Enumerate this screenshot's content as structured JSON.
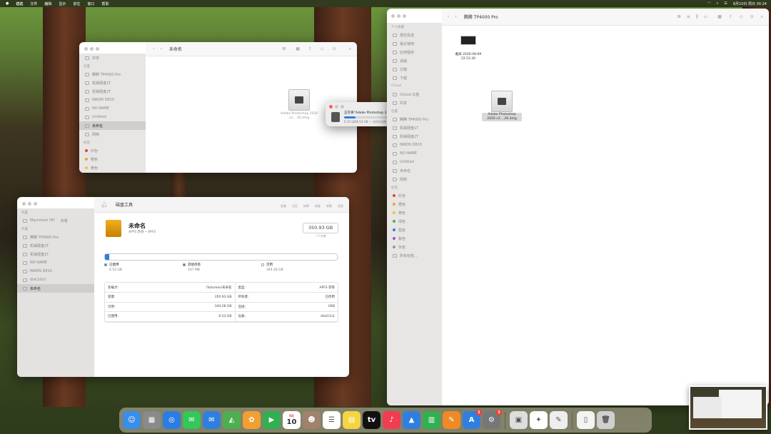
{
  "menubar": {
    "items": [
      "访达",
      "文件",
      "编辑",
      "显示",
      "前往",
      "窗口",
      "帮助"
    ],
    "datetime": "8月10日 周日 00:24"
  },
  "finder_small": {
    "title": "未命名",
    "sidebar": [
      {
        "type": "item",
        "label": "共享"
      },
      {
        "type": "head",
        "label": "位置"
      },
      {
        "type": "item",
        "label": "腾腾 TP4000 Pro"
      },
      {
        "type": "item",
        "label": "机械硬盘1T"
      },
      {
        "type": "item",
        "label": "机械硬盘2T"
      },
      {
        "type": "item",
        "label": "NIKON D810"
      },
      {
        "type": "item",
        "label": "NO NAME"
      },
      {
        "type": "item",
        "label": "Untitled"
      },
      {
        "type": "item",
        "label": "未命名",
        "selected": true
      },
      {
        "type": "item",
        "label": "网络"
      },
      {
        "type": "head",
        "label": "标签"
      },
      {
        "type": "tag",
        "label": "红色",
        "color": "#e0443a"
      },
      {
        "type": "tag",
        "label": "橙色",
        "color": "#f0a030"
      },
      {
        "type": "tag",
        "label": "黄色",
        "color": "#e8c630"
      }
    ],
    "file_label": "Adobe Photoshop 2026 v2....26.dmg"
  },
  "copy_dialog": {
    "title": "正在将“Adobe Photoshop 2...26.0.0.26.dmg”拷贝至“未命名”",
    "progress_pct": 12,
    "detail": "6.15 GB/6.52 GB — 大约1分钟"
  },
  "finder_large": {
    "title": "腾腾 TP4000 Pro",
    "sidebar": [
      {
        "type": "head",
        "label": "个人收藏"
      },
      {
        "type": "item",
        "label": "隔空投送"
      },
      {
        "type": "item",
        "label": "最近使用"
      },
      {
        "type": "item",
        "label": "应用程序"
      },
      {
        "type": "item",
        "label": "桌面"
      },
      {
        "type": "item",
        "label": "文稿"
      },
      {
        "type": "item",
        "label": "下载"
      },
      {
        "type": "head",
        "label": "iCloud"
      },
      {
        "type": "item",
        "label": "iCloud 云盘"
      },
      {
        "type": "item",
        "label": "共享"
      },
      {
        "type": "head",
        "label": "位置"
      },
      {
        "type": "item",
        "label": "腾腾 TP4000 Pro"
      },
      {
        "type": "item",
        "label": "机械硬盘1T"
      },
      {
        "type": "item",
        "label": "机械硬盘2T"
      },
      {
        "type": "item",
        "label": "NIKON D810"
      },
      {
        "type": "item",
        "label": "NO NAME"
      },
      {
        "type": "item",
        "label": "Untitled"
      },
      {
        "type": "item",
        "label": "未命名"
      },
      {
        "type": "item",
        "label": "网络"
      },
      {
        "type": "head",
        "label": "标签"
      },
      {
        "type": "tag",
        "label": "红色",
        "color": "#e0443a"
      },
      {
        "type": "tag",
        "label": "橙色",
        "color": "#f0a030"
      },
      {
        "type": "tag",
        "label": "黄色",
        "color": "#e8c630"
      },
      {
        "type": "tag",
        "label": "绿色",
        "color": "#4caf50"
      },
      {
        "type": "tag",
        "label": "蓝色",
        "color": "#2f7fe0"
      },
      {
        "type": "tag",
        "label": "紫色",
        "color": "#a050d0"
      },
      {
        "type": "tag",
        "label": "灰色",
        "color": "#999999"
      },
      {
        "type": "item",
        "label": "所有标签..."
      }
    ],
    "files": [
      {
        "label1": "截屏 2026-08-09",
        "label2": "22.53.30"
      },
      {
        "label1": "Adobe Photoshop",
        "label2": "2026 v2....26.dmg"
      }
    ]
  },
  "disk_utility": {
    "app_title": "磁盘工具",
    "toolbar_view": "显示",
    "toolbar": [
      "急救",
      "分区",
      "抹掉",
      "恢复",
      "卸载",
      "信息"
    ],
    "sidebar": [
      {
        "type": "head",
        "label": "内置"
      },
      {
        "type": "item",
        "label": "Macintosh HD",
        "badge": "宗卷"
      },
      {
        "type": "head",
        "label": "外置"
      },
      {
        "type": "item",
        "label": "腾腾 TP4000 Pro"
      },
      {
        "type": "item",
        "label": "机械硬盘2T"
      },
      {
        "type": "item",
        "label": "机械硬盘1T"
      },
      {
        "type": "item",
        "label": "NO NAME"
      },
      {
        "type": "item",
        "label": "NIKON D810"
      },
      {
        "type": "item",
        "label": "disk10s3"
      },
      {
        "type": "item",
        "label": "未命名",
        "selected": true
      }
    ],
    "volume_name": "未命名",
    "volume_sub": "APFS 宗卷 • APFS",
    "capacity": "350.93 GB",
    "capacity_note": "一个宗卷",
    "used_fraction": 0.019,
    "legend": [
      {
        "label": "已使用",
        "value": "6.53 GB",
        "color": "#2f7fe0"
      },
      {
        "label": "其他宗卷",
        "value": "147 MB",
        "color": "#777777"
      },
      {
        "label": "可用",
        "value": "344.28 GB",
        "color": "#ffffff"
      }
    ],
    "info_rows": [
      [
        "装载点:",
        "/Volumes/未命名",
        "类型:",
        "APFS 宗卷"
      ],
      [
        "容量:",
        "350.93 GB",
        "所有者:",
        "已停用"
      ],
      [
        "可用:",
        "344.28 GB",
        "连接:",
        "USB"
      ],
      [
        "已使用:",
        "6.53 GB",
        "设备:",
        "disk11s1"
      ]
    ]
  },
  "dock": {
    "calendar_month": "8月",
    "calendar_day": "10",
    "appstore_badge": "1",
    "settings_badge": "2"
  }
}
